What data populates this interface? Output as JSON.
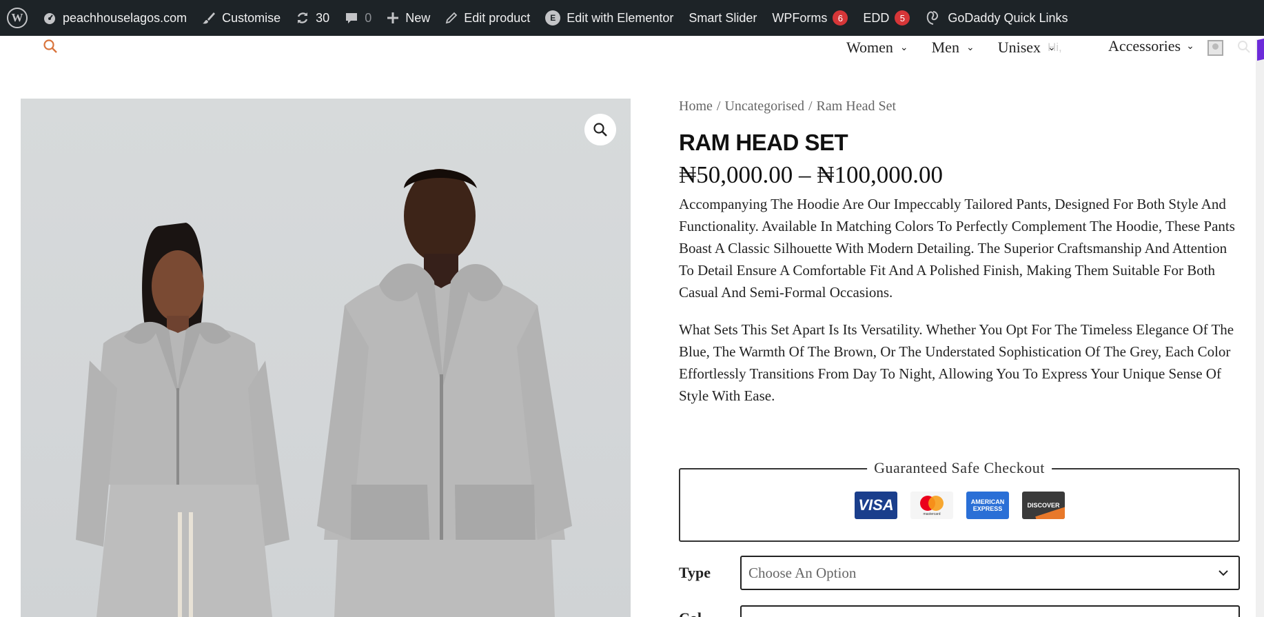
{
  "adminbar": {
    "site_name": "peachhouselagos.com",
    "customise": "Customise",
    "updates_count": "30",
    "comments_count": "0",
    "new_label": "New",
    "edit_product": "Edit product",
    "elementor_label": "Edit with Elementor",
    "smart_slider": "Smart Slider",
    "wpforms_label": "WPForms",
    "wpforms_badge": "6",
    "edd_label": "EDD",
    "edd_badge": "5",
    "godaddy_label": "GoDaddy Quick Links"
  },
  "nav": {
    "items": [
      {
        "label": "Women"
      },
      {
        "label": "Men"
      },
      {
        "label": "Unisex"
      },
      {
        "label": "Accessories"
      }
    ],
    "greeting": "Hi,"
  },
  "product": {
    "breadcrumb": [
      "Home",
      "/",
      "Uncategorised",
      "/",
      "Ram Head Set"
    ],
    "title": "RAM HEAD SET",
    "price": "₦50,000.00 – ₦100,000.00",
    "description": [
      "Accompanying The Hoodie Are Our Impeccably Tailored Pants, Designed For Both Style And Functionality. Available In Matching Colors To Perfectly Complement The Hoodie, These Pants Boast A Classic Silhouette With Modern Detailing. The Superior Craftsmanship And Attention To Detail Ensure A Comfortable Fit And A Polished Finish, Making Them Suitable For Both Casual And Semi-Formal Occasions.",
      "What Sets This Set Apart Is Its Versatility. Whether You Opt For The Timeless Elegance Of The Blue, The Warmth Of The Brown, Or The Understated Sophistication Of The Grey, Each Color Effortlessly Transitions From Day To Night, Allowing You To Express Your Unique Sense Of Style With Ease."
    ]
  },
  "checkout": {
    "legend": "Guaranteed Safe Checkout",
    "cards": {
      "visa": "VISA",
      "mastercard": "mastercard",
      "amex_line1": "AMERICAN",
      "amex_line2": "EXPRESS",
      "discover": "DISCOVER"
    }
  },
  "variations": {
    "type_label": "Type",
    "type_placeholder": "Choose An Option",
    "color_label": "Col"
  },
  "colors": {
    "adminbar_bg": "#1d2327",
    "badge_red": "#d63638",
    "accent_orange": "#d9743c"
  }
}
